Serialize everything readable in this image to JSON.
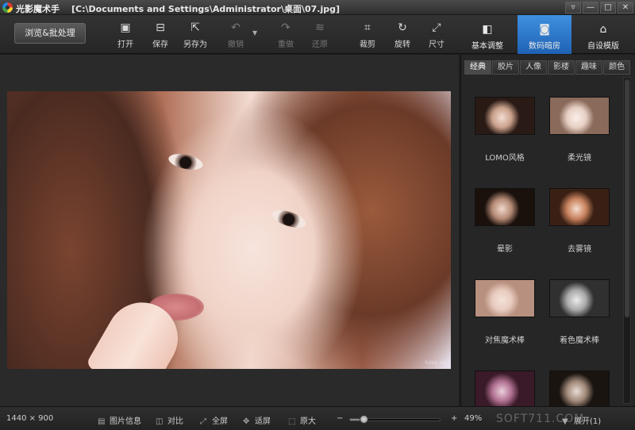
{
  "window": {
    "app_name": "光影魔术手",
    "document_path": "[C:\\Documents and Settings\\Administrator\\桌面\\07.jpg]",
    "controls": {
      "menu": "▿",
      "minimize": "—",
      "maximize": "□",
      "close": "✕"
    }
  },
  "toolbar": {
    "browse_batch": "浏览&批处理",
    "tools": [
      {
        "label": "打开",
        "icon": "open-icon",
        "glyph": "▣"
      },
      {
        "label": "保存",
        "icon": "save-icon",
        "glyph": "⊟"
      },
      {
        "label": "另存为",
        "icon": "save-as-icon",
        "glyph": "⇱"
      },
      {
        "label": "撤销",
        "icon": "undo-icon",
        "glyph": "↶"
      },
      {
        "label": "重做",
        "icon": "redo-icon",
        "glyph": "↷"
      },
      {
        "label": "还原",
        "icon": "restore-icon",
        "glyph": "≋"
      },
      {
        "label": "裁剪",
        "icon": "crop-icon",
        "glyph": "⌗"
      },
      {
        "label": "旋转",
        "icon": "rotate-icon",
        "glyph": "↻"
      },
      {
        "label": "尺寸",
        "icon": "resize-icon",
        "glyph": "⤢"
      }
    ],
    "undo_dropdown": "▼",
    "tabs": [
      {
        "label": "基本调整",
        "icon": "basic-adjust-icon",
        "glyph": "◧"
      },
      {
        "label": "数码暗房",
        "icon": "camera-icon",
        "glyph": "◙"
      },
      {
        "label": "自设模版",
        "icon": "template-icon",
        "glyph": "⌂"
      }
    ]
  },
  "photo": {
    "watermark": "kzoz.cn"
  },
  "panel": {
    "categories": [
      "经典",
      "胶片",
      "人像",
      "影楼",
      "趣味",
      "颜色"
    ],
    "filters": [
      {
        "label": "LOMO风格",
        "colors": [
          "#2a1a15",
          "#c9a08a",
          "#f2ddd2"
        ]
      },
      {
        "label": "柔光镜",
        "colors": [
          "#8a6a5a",
          "#e6cfc4",
          "#fbefe9"
        ]
      },
      {
        "label": "晕影",
        "colors": [
          "#1a100c",
          "#b58a74",
          "#f0d8cc"
        ]
      },
      {
        "label": "去雾镜",
        "colors": [
          "#3a2014",
          "#c8825e",
          "#f6dccd"
        ]
      },
      {
        "label": "对焦魔术棒",
        "colors": [
          "#b89080",
          "#e8cbbe",
          "#f4e2da"
        ]
      },
      {
        "label": "着色魔术棒",
        "colors": [
          "#303030",
          "#a8a8a8",
          "#ececec"
        ]
      },
      {
        "label": "",
        "colors": [
          "#3a1a28",
          "#b07090",
          "#ecd0dc"
        ]
      },
      {
        "label": "",
        "colors": [
          "#1a1410",
          "#a08878",
          "#e8dcd4"
        ]
      }
    ]
  },
  "statusbar": {
    "dimensions": "1440 × 900",
    "image_info": "图片信息",
    "compare": "对比",
    "fullscreen": "全屏",
    "fit_screen": "适屏",
    "original_size": "原大",
    "zoom_minus": "−",
    "zoom_plus": "+",
    "zoom_level": "49%",
    "zoom_fraction": 0.15,
    "expand": "展开(1)",
    "site_watermark": "SOFT711.COM"
  }
}
